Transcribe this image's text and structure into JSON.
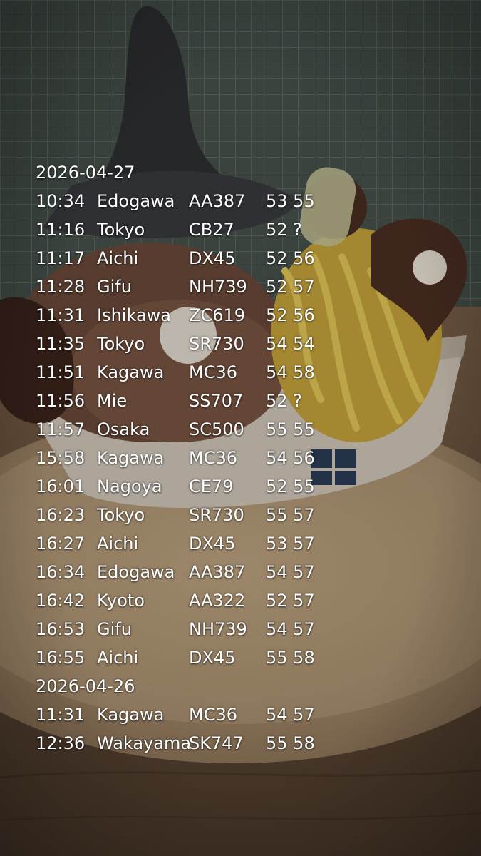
{
  "log": {
    "groups": [
      {
        "date": "2026-04-27",
        "entries": [
          {
            "time": "10:34",
            "place": "Edogawa",
            "code": "AA387",
            "nums": "53 55"
          },
          {
            "time": "11:16",
            "place": "Tokyo",
            "code": "CB27",
            "nums": "52 ?"
          },
          {
            "time": "11:17",
            "place": "Aichi",
            "code": "DX45",
            "nums": "52 56"
          },
          {
            "time": "11:28",
            "place": "Gifu",
            "code": "NH739",
            "nums": "52 57"
          },
          {
            "time": "11:31",
            "place": "Ishikawa",
            "code": "ZC619",
            "nums": "52 56"
          },
          {
            "time": "11:35",
            "place": "Tokyo",
            "code": "SR730",
            "nums": "54 54"
          },
          {
            "time": "11:51",
            "place": "Kagawa",
            "code": "MC36",
            "nums": "54 58"
          },
          {
            "time": "11:56",
            "place": "Mie",
            "code": "SS707",
            "nums": "52 ?"
          },
          {
            "time": "11:57",
            "place": "Osaka",
            "code": "SC500",
            "nums": "55 55"
          },
          {
            "time": "15:58",
            "place": "Kagawa",
            "code": "MC36",
            "nums": "54 56"
          },
          {
            "time": "16:01",
            "place": "Nagoya",
            "code": "CE79",
            "nums": "52 55"
          },
          {
            "time": "16:23",
            "place": "Tokyo",
            "code": "SR730",
            "nums": "55 57"
          },
          {
            "time": "16:27",
            "place": "Aichi",
            "code": "DX45",
            "nums": "53 57"
          },
          {
            "time": "16:34",
            "place": "Edogawa",
            "code": "AA387",
            "nums": "54 57"
          },
          {
            "time": "16:42",
            "place": "Kyoto",
            "code": "AA322",
            "nums": "52 57"
          },
          {
            "time": "16:53",
            "place": "Gifu",
            "code": "NH739",
            "nums": "54 57"
          },
          {
            "time": "16:55",
            "place": "Aichi",
            "code": "DX45",
            "nums": "55 58"
          }
        ]
      },
      {
        "date": "2026-04-26",
        "entries": [
          {
            "time": "11:31",
            "place": "Kagawa",
            "code": "MC36",
            "nums": "54 57"
          },
          {
            "time": "12:36",
            "place": "Wakayama",
            "code": "SK747",
            "nums": "55 58"
          }
        ]
      }
    ]
  },
  "photo": {
    "subject": "dessert-cup-with-chestnut-cream-and-witch-hat",
    "colors": {
      "wall": "#3f4a45",
      "table": "#8a6c4e",
      "tray": "#b59a76",
      "cup": "#d4cabb",
      "cream": "#d7b843",
      "chocolate": "#4a2e22",
      "hat": "#2f3033"
    }
  }
}
